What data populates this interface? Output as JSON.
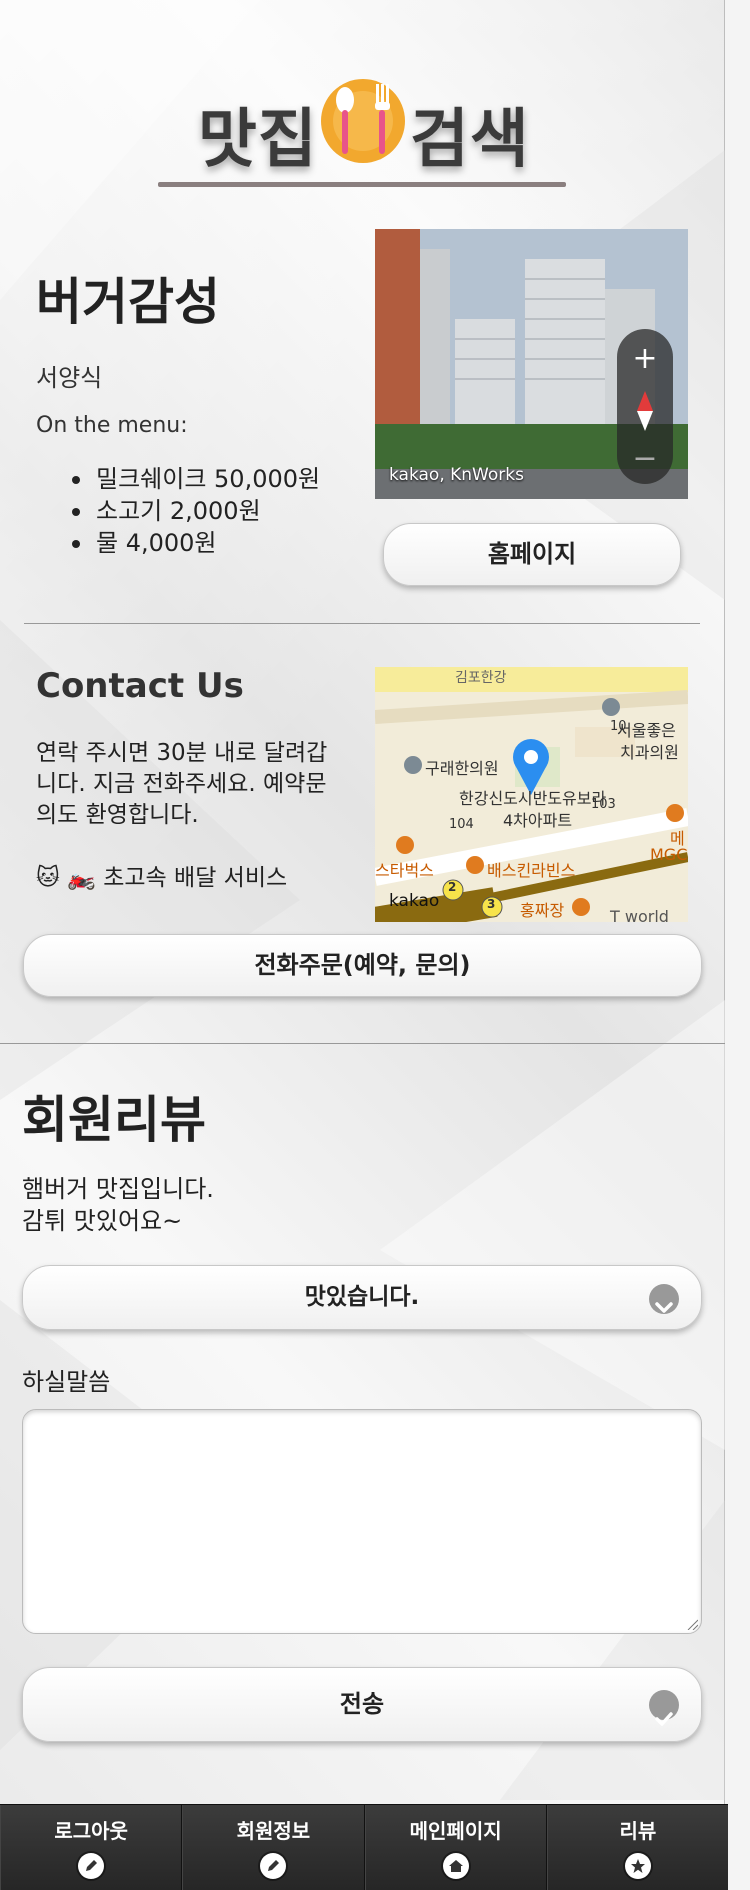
{
  "header": {
    "logo_left": "맛집",
    "logo_right": "검색"
  },
  "restaurant": {
    "name": "버거감성",
    "category": "서양식",
    "menu_label": "On the menu:",
    "menu_items": [
      "밀크쉐이크 50,000원",
      "소고기 2,000원",
      "물 4,000원"
    ],
    "roadview_credit": "kakao, KnWorks",
    "homepage_button": "홈페이지"
  },
  "contact": {
    "title": "Contact Us",
    "text": "연락 주시면 30분 내로 달려갑니다. 지금 전화주세요. 예약문의도 환영합니다.",
    "service": "🐱 🏍️ 초고속 배달 서비스",
    "call_button": "전화주문(예약, 문의)",
    "map": {
      "labels": [
        "김포한강",
        "구래한의원",
        "서울좋은",
        "치과의원",
        "한강신도시반도유보라",
        "4차아파트",
        "104",
        "103",
        "스타벅스",
        "배스킨라빈스",
        "메",
        "MGC",
        "홍짜장",
        "T world",
        "kakao",
        "2",
        "3",
        "10"
      ]
    }
  },
  "reviews": {
    "title": "회원리뷰",
    "lines": [
      "햄버거 맛집입니다.",
      "감튀 맛있어요~"
    ],
    "select_value": "맛있습니다.",
    "comment_label": "하실말씀",
    "submit_button": "전송"
  },
  "navbar": {
    "items": [
      {
        "label": "로그아웃",
        "icon": "pencil-icon"
      },
      {
        "label": "회원정보",
        "icon": "pencil-icon"
      },
      {
        "label": "메인페이지",
        "icon": "home-icon"
      },
      {
        "label": "리뷰",
        "icon": "star-icon"
      }
    ]
  },
  "colors": {
    "accent_plate": "#f2a82e",
    "utensil_pink": "#e8548a",
    "map_marker": "#2b8ef0",
    "nav_bg": "#2e2e2e"
  }
}
